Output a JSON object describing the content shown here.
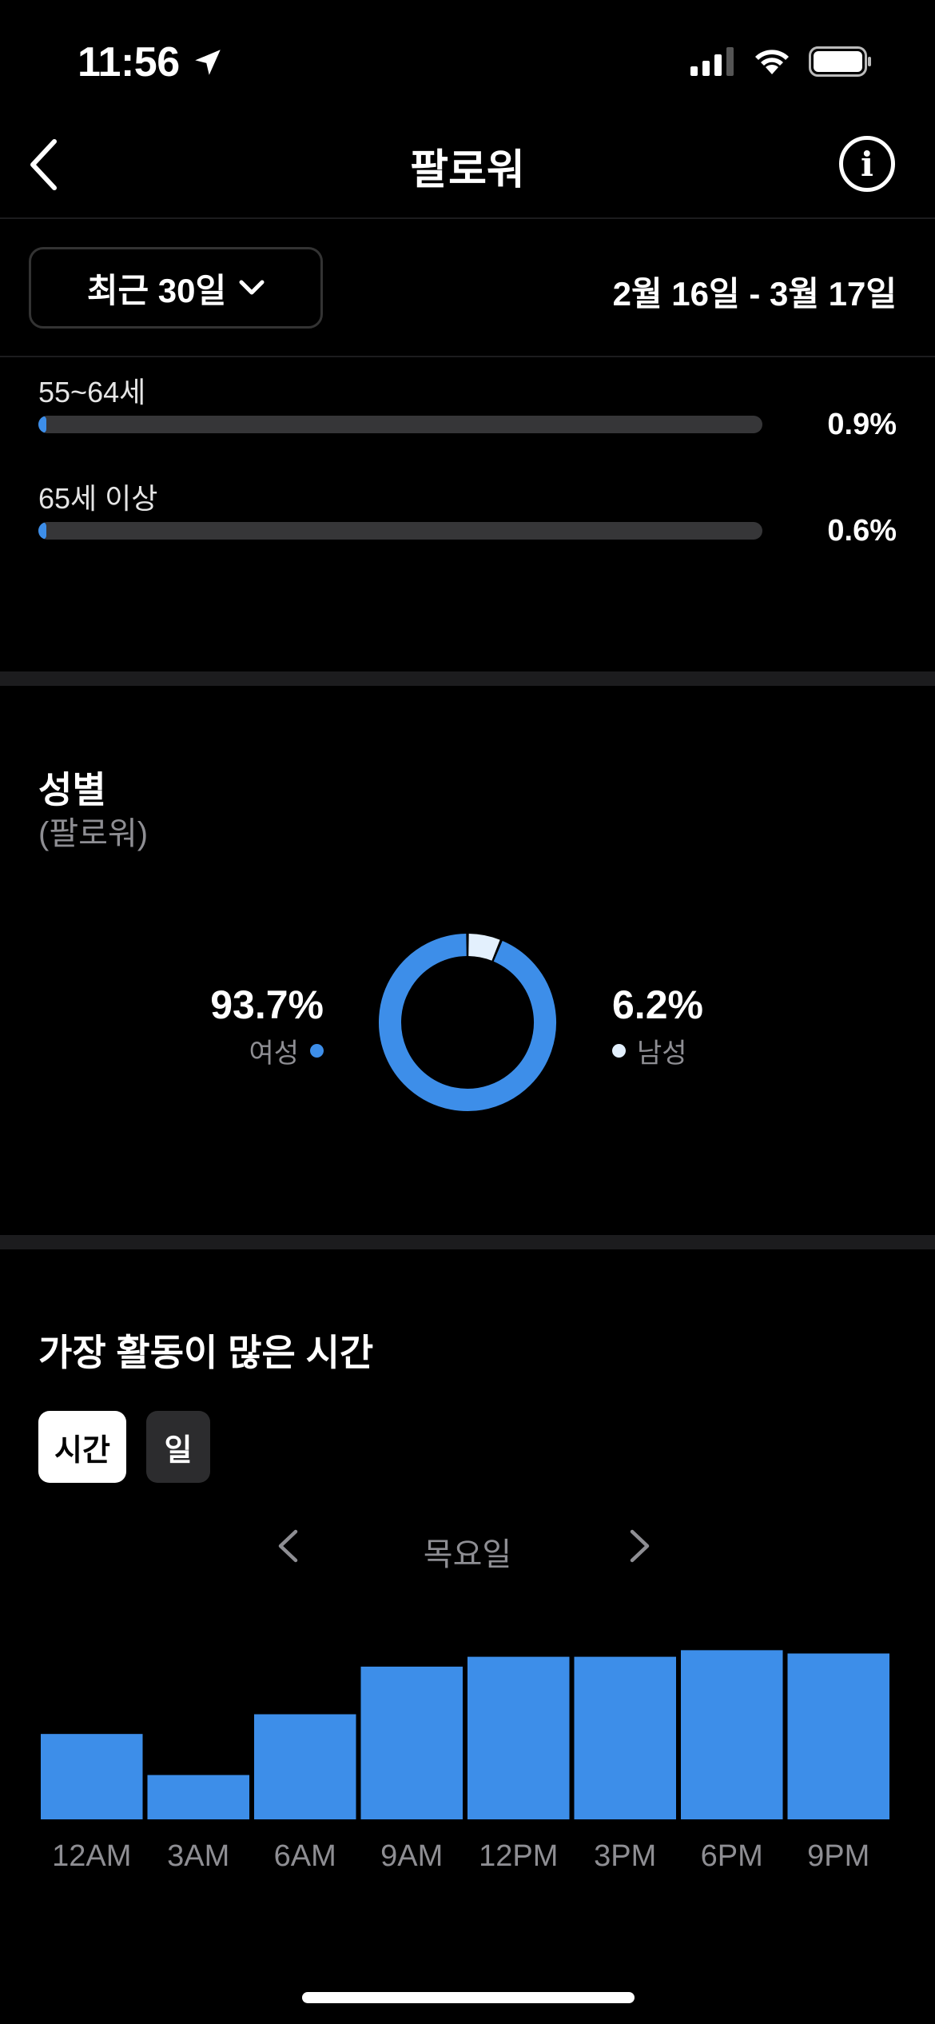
{
  "status_bar": {
    "time": "11:56"
  },
  "nav": {
    "title": "팔로워"
  },
  "range": {
    "label": "최근 30일",
    "dates": "2월 16일 - 3월 17일"
  },
  "age_groups": [
    {
      "label": "55~64세",
      "percent": "0.9%",
      "fraction": 0.009
    },
    {
      "label": "65세 이상",
      "percent": "0.6%",
      "fraction": 0.006
    }
  ],
  "gender": {
    "title": "성별",
    "subtitle": "(팔로워)",
    "female": {
      "percent": "93.7%",
      "label": "여성",
      "value": 93.7,
      "color": "#3d8ee9"
    },
    "male": {
      "percent": "6.2%",
      "label": "남성",
      "value": 6.2,
      "color": "#e3f0fd"
    }
  },
  "active_times": {
    "title": "가장 활동이 많은 시간",
    "toggle_hours": "시간",
    "toggle_days": "일",
    "day": "목요일"
  },
  "chart_data": {
    "type": "bar",
    "categories": [
      "12AM",
      "3AM",
      "6AM",
      "9AM",
      "12PM",
      "3PM",
      "6PM",
      "9PM"
    ],
    "values": [
      52,
      27,
      64,
      93,
      99,
      99,
      103,
      101
    ],
    "ylim": [
      0,
      110
    ],
    "grid": false,
    "color": "#3d8ee9"
  }
}
